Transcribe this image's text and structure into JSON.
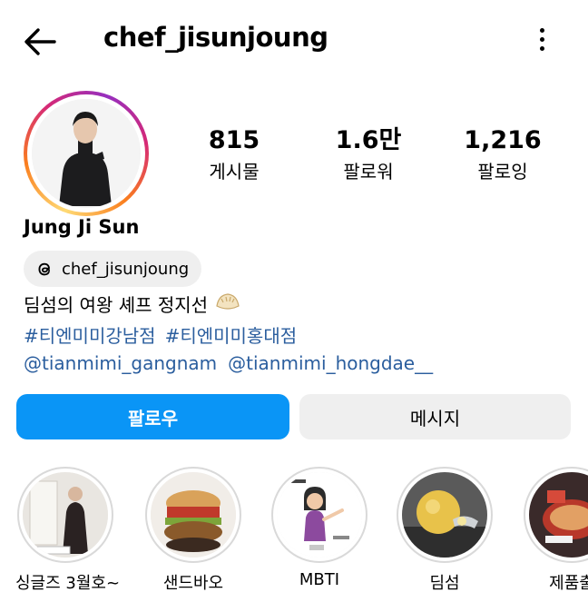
{
  "header": {
    "username": "chef_jisunjoung"
  },
  "stats": [
    {
      "value": "815",
      "label": "게시물"
    },
    {
      "value": "1.6만",
      "label": "팔로워"
    },
    {
      "value": "1,216",
      "label": "팔로잉"
    }
  ],
  "profile": {
    "name": "Jung Ji Sun",
    "threads_handle": "chef_jisunjoung",
    "bio": "딤섬의 여왕 셰프 정지선",
    "hashtags": [
      "#티엔미미강남점",
      "#티엔미미홍대점"
    ],
    "mentions": [
      "@tianmimi_gangnam",
      "@tianmimi_hongdae__"
    ]
  },
  "actions": {
    "follow": "팔로우",
    "message": "메시지"
  },
  "highlights": [
    {
      "label": "싱글즈 3월호~"
    },
    {
      "label": "샌드바오"
    },
    {
      "label": "MBTI"
    },
    {
      "label": "딤섬"
    },
    {
      "label": "제품출"
    }
  ],
  "colors": {
    "link": "#2b5e9e",
    "follow_button": "#0a95f6",
    "secondary_button": "#efefef"
  }
}
